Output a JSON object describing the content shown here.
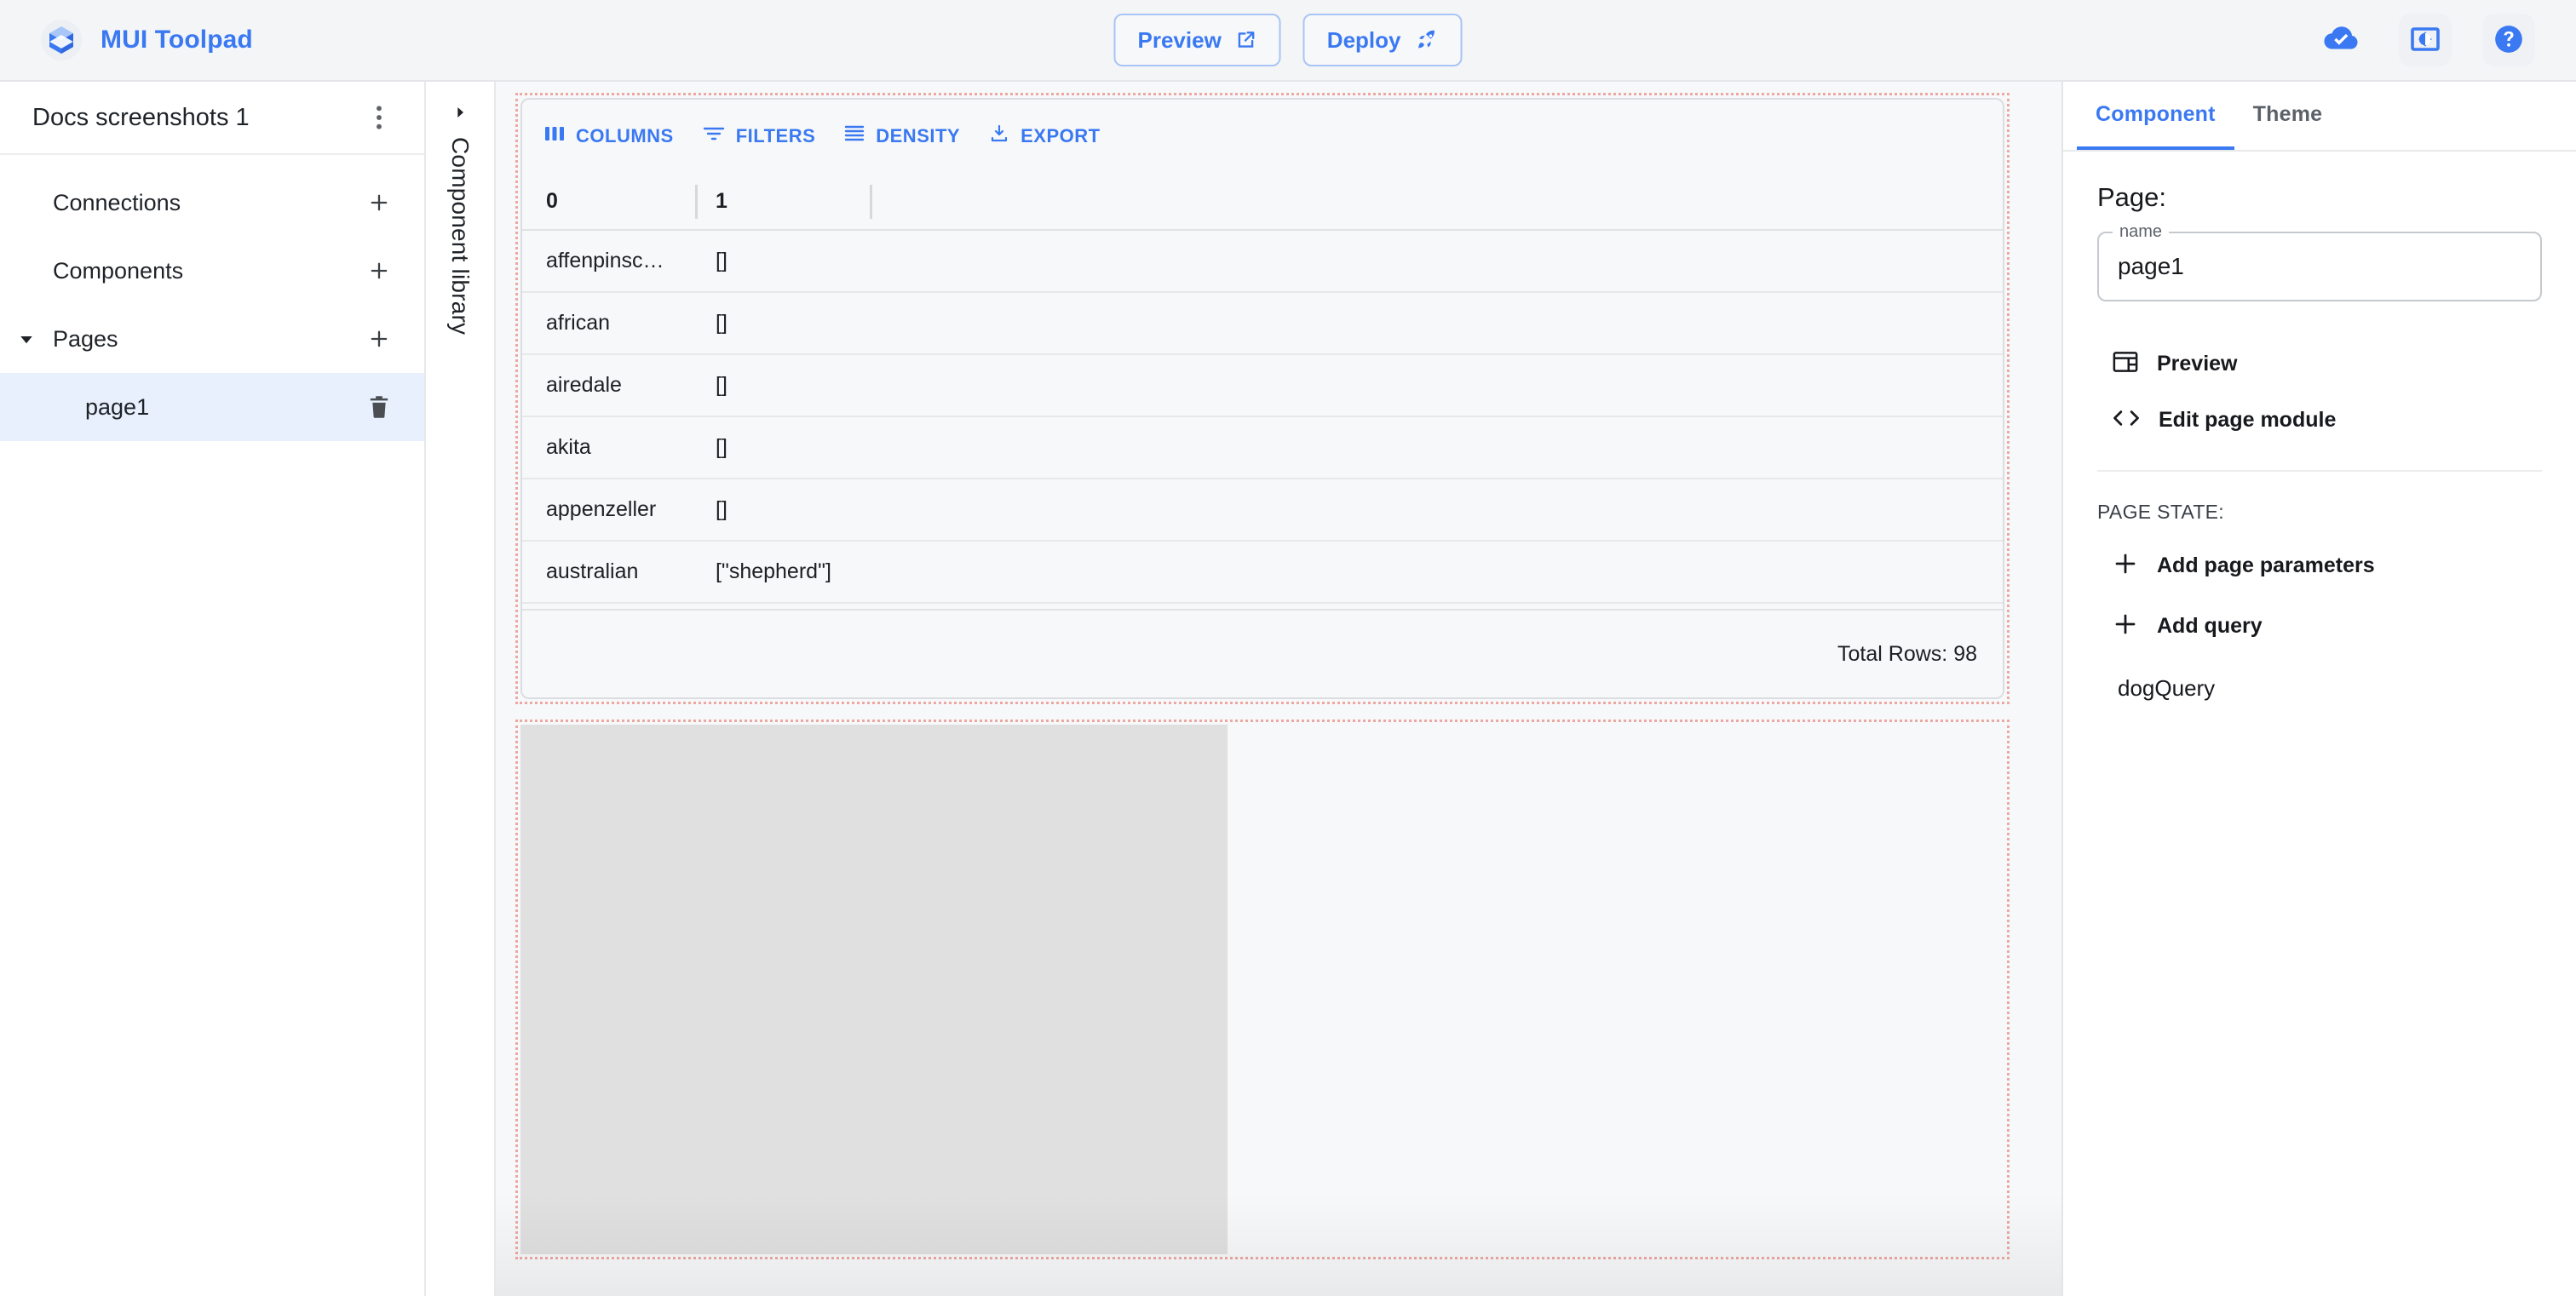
{
  "header": {
    "brand": "MUI Toolpad",
    "logo_icon": "toolpad-logo-icon",
    "preview_label": "Preview",
    "preview_icon": "open-in-new-icon",
    "deploy_label": "Deploy",
    "deploy_icon": "rocket-icon",
    "cloud_icon": "cloud-done-icon",
    "theme_icon": "brightness-settings-icon",
    "help_icon": "help-circle-icon",
    "accent_color": "#3a79f2",
    "background_color": "#f4f5f7"
  },
  "sidebar": {
    "title": "Docs screenshots 1",
    "more_icon": "more-vertical-icon",
    "sections": [
      {
        "label": "Connections",
        "add_icon": "plus-icon",
        "expandable": false
      },
      {
        "label": "Components",
        "add_icon": "plus-icon",
        "expandable": false
      },
      {
        "label": "Pages",
        "add_icon": "plus-icon",
        "expandable": true,
        "caret_icon": "caret-down-icon"
      }
    ],
    "pages": [
      {
        "label": "page1",
        "selected": true,
        "delete_icon": "trash-icon"
      }
    ]
  },
  "rail": {
    "label": "Component library",
    "caret_icon": "caret-right-icon"
  },
  "canvas": {
    "grid": {
      "toolbar": [
        {
          "label": "COLUMNS",
          "icon": "columns-icon"
        },
        {
          "label": "FILTERS",
          "icon": "filter-icon"
        },
        {
          "label": "DENSITY",
          "icon": "density-icon"
        },
        {
          "label": "EXPORT",
          "icon": "export-download-icon"
        }
      ],
      "columns": [
        "0",
        "1"
      ],
      "rows": [
        {
          "c0": "affenpinsc…",
          "c1": "[]"
        },
        {
          "c0": "african",
          "c1": "[]"
        },
        {
          "c0": "airedale",
          "c1": "[]"
        },
        {
          "c0": "akita",
          "c1": "[]"
        },
        {
          "c0": "appenzeller",
          "c1": "[]"
        },
        {
          "c0": "australian",
          "c1": "[\"shepherd\"]"
        }
      ],
      "footer": "Total Rows: 98"
    },
    "placeholder": {
      "fill_color": "#e0e0e0"
    },
    "selection_outline_color": "#eda8a3"
  },
  "rightpanel": {
    "tabs": [
      {
        "label": "Component",
        "active": true
      },
      {
        "label": "Theme",
        "active": false
      }
    ],
    "heading": "Page:",
    "name_field": {
      "legend": "name",
      "value": "page1"
    },
    "actions": [
      {
        "label": "Preview",
        "icon": "web-layout-icon"
      },
      {
        "label": "Edit page module",
        "icon": "code-brackets-icon"
      }
    ],
    "section_title": "PAGE STATE:",
    "state_actions": [
      {
        "label": "Add page parameters",
        "icon": "plus-icon"
      },
      {
        "label": "Add query",
        "icon": "plus-icon"
      }
    ],
    "queries": [
      {
        "label": "dogQuery"
      }
    ]
  }
}
